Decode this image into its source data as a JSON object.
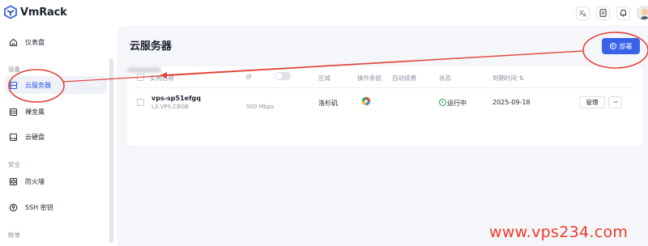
{
  "app": {
    "name": "VmRack"
  },
  "topbar": {
    "translate_icon": "translate-icon",
    "doc_icon": "document-icon",
    "bell_icon": "bell-icon"
  },
  "sidebar": {
    "dashboard": "仪表盘",
    "section_device": "设备",
    "cloud_server": "云服务器",
    "bare_metal": "裸金属",
    "cloud_disk": "云硬盘",
    "section_security": "安全",
    "firewall": "防火墙",
    "ssh_key": "SSH 密钥",
    "section_billing": "账单"
  },
  "main": {
    "title": "云服务器",
    "deploy_label": "部署",
    "columns": {
      "name": "实例名称",
      "ip": "IP",
      "region": "区域",
      "os": "操作系统",
      "auto_renew": "自动续费",
      "status": "状态",
      "expires": "到期时间 ⇅"
    },
    "rows": [
      {
        "name": "vps-sp51efgq",
        "plan": "L3.VPS.C8GB",
        "bandwidth": "500 Mbps",
        "region": "洛杉矶",
        "os_icon": "os-logo-icon",
        "auto_renew": false,
        "status": "运行中",
        "expires": "2025-09-18",
        "manage": "管理",
        "more": "···"
      }
    ]
  },
  "watermark": "www.vps234.com",
  "colors": {
    "accent": "#3a62e8",
    "annotation": "#e0453a",
    "running": "#2aa44f"
  }
}
